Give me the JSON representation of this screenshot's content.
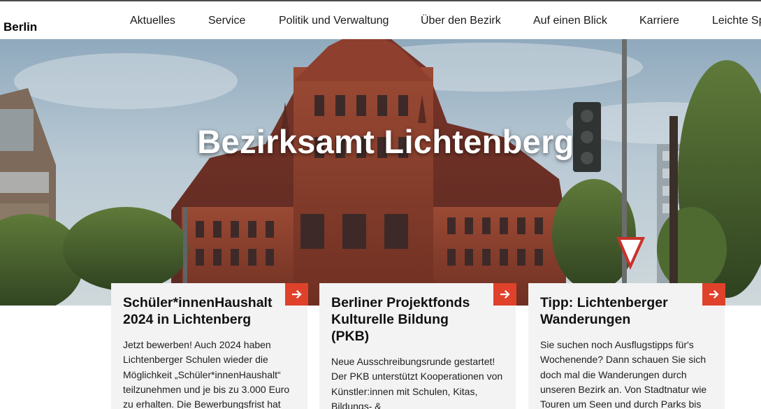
{
  "header": {
    "brand": "Berlin",
    "nav": [
      {
        "label": "Aktuelles"
      },
      {
        "label": "Service"
      },
      {
        "label": "Politik und Verwaltung"
      },
      {
        "label": "Über den Bezirk"
      },
      {
        "label": "Auf einen Blick"
      },
      {
        "label": "Karriere"
      },
      {
        "label": "Leichte Sprache"
      }
    ]
  },
  "hero": {
    "title": "Bezirksamt Lichtenberg"
  },
  "cards": [
    {
      "title": "Schüler*innenHaushalt 2024 in Lichtenberg",
      "text": "Jetzt bewerben! Auch 2024 haben Lichtenberger Schulen wieder die Möglichkeit „Schüler*innenHaushalt“ teilzunehmen und je bis zu 3.000 Euro zu erhalten. Die Bewerbungsfrist hat"
    },
    {
      "title": "Berliner Projektfonds Kulturelle Bildung (PKB)",
      "text": "Neue Ausschreibungsrunde gestartet! Der PKB unterstützt Kooperationen von Künstler:innen mit Schulen, Kitas, Bildungs- & Jugendfreizeiteinrichtungen."
    },
    {
      "title": "Tipp: Lichtenberger Wanderungen",
      "text": "Sie suchen noch Ausflugstipps für's Wochenende? Dann schauen Sie sich doch mal die Wanderungen durch unseren Bezirk an. Von Stadtnatur wie Touren um Seen und durch Parks bis"
    }
  ],
  "colors": {
    "accent": "#e0412a",
    "card_bg": "#f3f3f3",
    "brick": "#8a3a2a"
  },
  "icons": {
    "card_arrow": "arrow-right-icon"
  }
}
